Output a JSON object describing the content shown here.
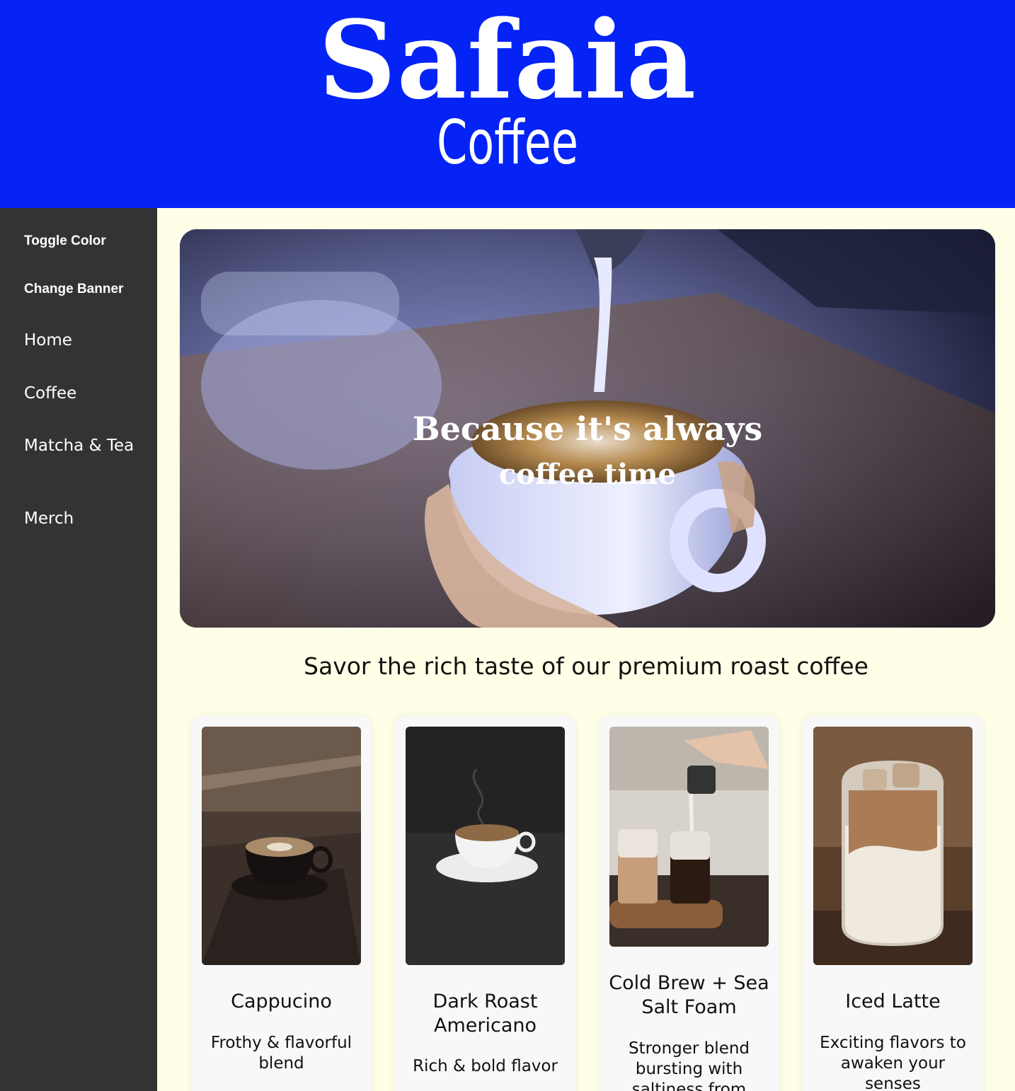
{
  "header": {
    "logo_line1": "Safaia",
    "logo_line2": "Coffee"
  },
  "sidebar": {
    "toggle_color_label": "Toggle Color",
    "change_banner_label": "Change Banner",
    "nav": [
      {
        "label": "Home"
      },
      {
        "label": "Coffee"
      },
      {
        "label": "Matcha & Tea"
      },
      {
        "label": "Merch"
      }
    ]
  },
  "banner": {
    "text_line1": "Because it's always",
    "text_line2": "coffee time"
  },
  "tagline": "Savor the rich taste of our premium roast coffee",
  "products": [
    {
      "name": "Cappucino",
      "description": "Frothy & flavorful blend"
    },
    {
      "name": "Dark Roast Americano",
      "description": "Rich & bold flavor"
    },
    {
      "name": "Cold Brew + Sea Salt Foam",
      "description": "Stronger blend bursting with saltiness from"
    },
    {
      "name": "Iced Latte",
      "description": "Exciting flavors to awaken your senses"
    }
  ],
  "colors": {
    "header_bg": "#0523f5",
    "sidebar_bg": "#333333",
    "page_bg": "#fffee6",
    "card_bg": "#f8f8f8"
  }
}
